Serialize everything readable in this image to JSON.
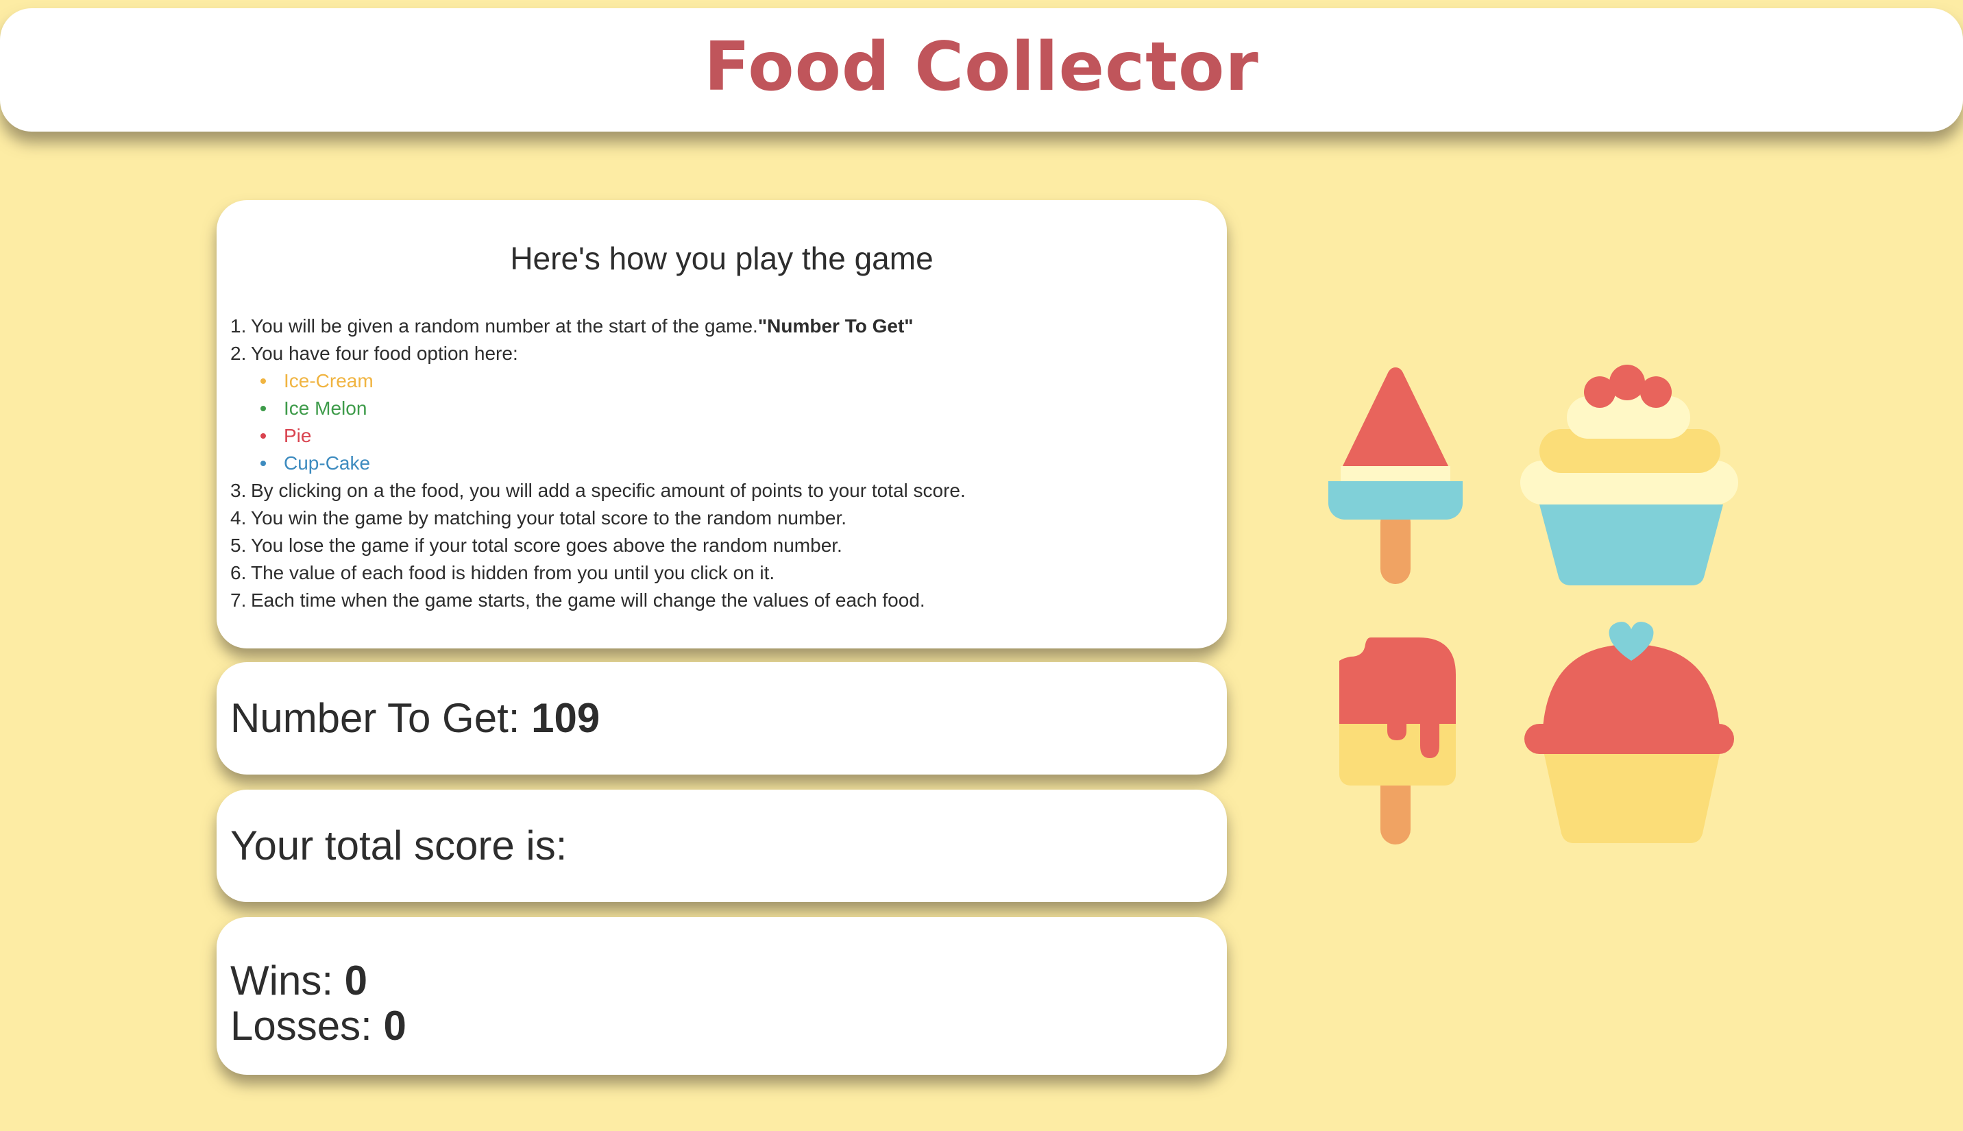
{
  "header": {
    "title": "Food Collector"
  },
  "instructions": {
    "heading": "Here's how you play the game",
    "steps": [
      {
        "num": "1.",
        "text": "You will be given a random number at the start of the game.",
        "bold": "\"Number To Get\""
      },
      {
        "num": "2.",
        "text": "You have four food option here:"
      },
      {
        "num": "3.",
        "text": "By clicking on a the food, you will add a specific amount of points to your total score."
      },
      {
        "num": "4.",
        "text": "You win the game by matching your total score to the random number."
      },
      {
        "num": "5.",
        "text": "You lose the game if your total score goes above the random number."
      },
      {
        "num": "6.",
        "text": "The value of each food is hidden from you until you click on it."
      },
      {
        "num": "7.",
        "text": "Each time when the game starts, the game will change the values of each food."
      }
    ],
    "foods": [
      {
        "label": "Ice-Cream",
        "color": "#f0b441"
      },
      {
        "label": "Ice Melon",
        "color": "#3e9b4a"
      },
      {
        "label": "Pie",
        "color": "#d9434f"
      },
      {
        "label": "Cup-Cake",
        "color": "#3d8bbf"
      }
    ]
  },
  "game": {
    "target_label": "Number To Get:",
    "target_value": "109",
    "score_label": "Your total score is:",
    "score_value": "",
    "wins_label": "Wins:",
    "wins_value": "0",
    "losses_label": "Losses:",
    "losses_value": "0"
  },
  "food_icons": [
    {
      "name": "ice-cream-icon"
    },
    {
      "name": "cupcake-cherry-icon"
    },
    {
      "name": "popsicle-bitten-icon"
    },
    {
      "name": "cupcake-heart-icon"
    }
  ],
  "colors": {
    "background": "#fdeca4",
    "title": "#c0555b",
    "red": "#e8645c",
    "cyan": "#80d0d8",
    "cream": "#fff8c6",
    "yellow": "#fbdd78",
    "orange": "#f0a363"
  }
}
